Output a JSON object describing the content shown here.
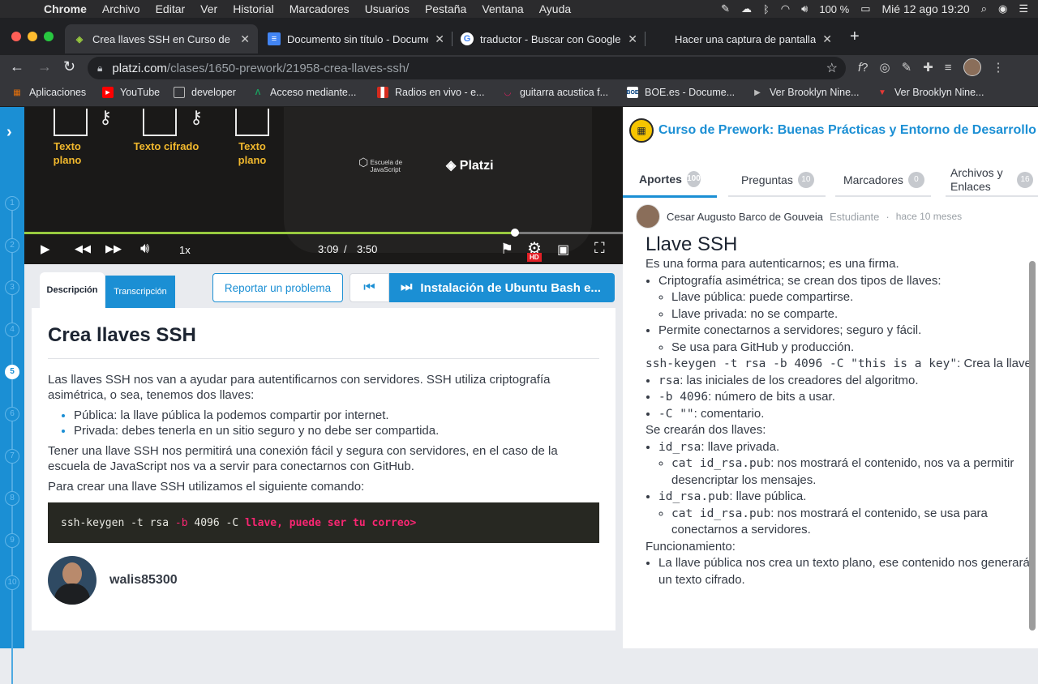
{
  "mac_menu": {
    "app": "Chrome",
    "items": [
      "Archivo",
      "Editar",
      "Ver",
      "Historial",
      "Marcadores",
      "Usuarios",
      "Pestaña",
      "Ventana",
      "Ayuda"
    ],
    "battery": "100 %",
    "datetime": "Mié 12 ago  19:20"
  },
  "tabs": [
    {
      "title": "Crea llaves SSH en Curso de Pr",
      "active": true,
      "icon": "platzi-icon"
    },
    {
      "title": "Documento sin título - Docume",
      "active": false,
      "icon": "docs-icon"
    },
    {
      "title": "traductor - Buscar con Google",
      "active": false,
      "icon": "google-icon"
    },
    {
      "title": "Hacer una captura de pantalla",
      "active": false,
      "icon": "apple-icon"
    }
  ],
  "url": {
    "host": "platzi.com",
    "path": "/clases/1650-prework/21958-crea-llaves-ssh/"
  },
  "bookmarks": [
    {
      "label": "Aplicaciones",
      "icon": "apps-grid-icon"
    },
    {
      "label": "YouTube",
      "icon": "youtube-icon"
    },
    {
      "label": "developer",
      "icon": "folder-icon"
    },
    {
      "label": "Acceso mediante...",
      "icon": "bookmark-a-icon"
    },
    {
      "label": "Radios en vivo - e...",
      "icon": "flag-icon"
    },
    {
      "label": "guitarra acustica f...",
      "icon": "bookmark-icon"
    },
    {
      "label": "BOE.es - Docume...",
      "icon": "boe-icon"
    },
    {
      "label": "Ver Brooklyn Nine...",
      "icon": "bookmark-icon"
    },
    {
      "label": "Ver Brooklyn Nine...",
      "icon": "popcorn-icon"
    }
  ],
  "sidebar_steps": [
    "1",
    "2",
    "3",
    "4",
    "5",
    "6",
    "7",
    "8",
    "9",
    "10"
  ],
  "video": {
    "labels": [
      "Texto plano",
      "Texto cifrado",
      "Texto plano"
    ],
    "school": "Escuela de JavaScript",
    "brand": "Platzi",
    "progress": 0.82,
    "speed": "1x",
    "current_time": "3:09",
    "separator": "/",
    "duration": "3:50",
    "quality": "HD"
  },
  "lesson_tabs": {
    "description": "Descripción",
    "transcription": "Transcripción"
  },
  "report_button": "Reportar un problema",
  "next_class": "Instalación de Ubuntu Bash e...",
  "lesson": {
    "title": "Crea llaves SSH",
    "p1": "Las llaves SSH nos van a ayudar para autentificarnos con servidores. SSH utiliza criptografía asimétrica, o sea, tenemos dos llaves:",
    "bullets": [
      "Pública: la llave pública la podemos compartir por internet.",
      "Privada: debes tenerla en un sitio seguro y no debe ser compartida."
    ],
    "p2": "Tener una llave SSH nos permitirá una conexión fácil y segura con servidores, en el caso de la escuela de JavaScript nos va a servir para conectarnos con GitHub.",
    "p3": "Para crear una llave SSH utilizamos el siguiente comando:",
    "code_a": "ssh-keygen -t rsa ",
    "code_b": "-b",
    "code_c": " 4096 -C ",
    "code_d": "llave, puede ser tu correo>",
    "author": "walis85300"
  },
  "course": {
    "title": "Curso de Prework: Buenas Prácticas y Entorno de Desarrollo"
  },
  "right_tabs": [
    {
      "label": "Aportes",
      "count": "100"
    },
    {
      "label": "Preguntas",
      "count": "10"
    },
    {
      "label": "Marcadores",
      "count": "0"
    },
    {
      "label": "Archivos y Enlaces",
      "count": "16"
    }
  ],
  "comment": {
    "author": "Cesar Augusto Barco de Gouveia",
    "role": "Estudiante",
    "dot": "·",
    "time": "hace 10 meses",
    "title": "Llave SSH",
    "l1": "Es una forma para autenticarnos; es una firma.",
    "b1": "Criptografía asimétrica; se crean dos tipos de llaves:",
    "b1a": "Llave pública: puede compartirse.",
    "b1b": "Llave privada: no se comparte.",
    "b2": "Permite conectarnos a servidores; seguro y fácil.",
    "b2a": "Se usa para GitHub y producción.",
    "cmd": "ssh-keygen -t rsa -b 4096 -C \"this is a key\"",
    "cmd_desc": ": Crea la llave:",
    "f1c": "rsa",
    "f1d": ": las iniciales de los creadores del algoritmo.",
    "f2c": "-b 4096",
    "f2d": ": número de bits a usar.",
    "f3c": "-C \"\"",
    "f3d": ": comentario.",
    "l2": "Se crearán dos llaves:",
    "k1c": "id_rsa",
    "k1d": ": llave privada.",
    "k1sc": "cat id_rsa.pub",
    "k1sd": ": nos mostrará el contenido, nos va a permitir desencriptar los mensajes.",
    "k2c": "id_rsa.pub",
    "k2d": ": llave pública.",
    "k2sc": "cat id_rsa.pub",
    "k2sd": ": nos mostrará el contenido, se usa para conectarnos a servidores.",
    "l3": "Funcionamiento:",
    "b3": "La llave pública nos crea un texto plano, ese contenido nos generará un texto cifrado."
  }
}
